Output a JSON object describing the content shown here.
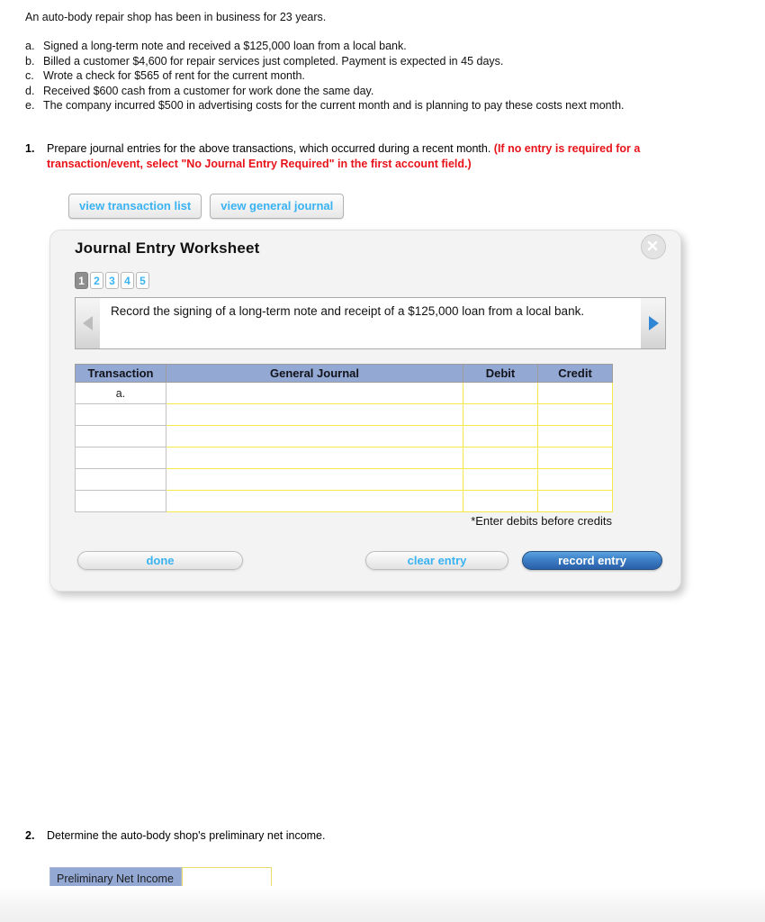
{
  "intro": "An auto-body repair shop has been in business for 23 years.",
  "transactions": [
    {
      "letter": "a.",
      "text": "Signed a long-term note and received a $125,000 loan from a local bank."
    },
    {
      "letter": "b.",
      "text": "Billed a customer $4,600 for repair services just completed. Payment is expected in 45 days."
    },
    {
      "letter": "c.",
      "text": "Wrote a check for $565 of rent for the current month."
    },
    {
      "letter": "d.",
      "text": "Received $600 cash from a customer for work done the same day."
    },
    {
      "letter": "e.",
      "text": "The company incurred $500 in advertising costs for the current month and is planning to pay these costs next month."
    }
  ],
  "question1": {
    "number": "1.",
    "text": "Prepare journal entries for the above transactions, which occurred during a recent month. ",
    "highlight": "(If no entry is required for a transaction/event, select \"No Journal Entry Required\" in the first account field.)"
  },
  "view_buttons": [
    {
      "label": "view transaction list"
    },
    {
      "label": "view general journal"
    }
  ],
  "worksheet": {
    "title": "Journal Entry Worksheet",
    "close_icon": "close-x-icon",
    "pager": [
      {
        "label": "1",
        "active": true
      },
      {
        "label": "2",
        "active": false
      },
      {
        "label": "3",
        "active": false
      },
      {
        "label": "4",
        "active": false
      },
      {
        "label": "5",
        "active": false
      }
    ],
    "prev_icon": "triangle-left-icon",
    "next_icon": "triangle-right-icon",
    "prompt": "Record the signing of a long-term note and receipt of a $125,000 loan from a local bank.",
    "table": {
      "headers": [
        "Transaction",
        "General Journal",
        "Debit",
        "Credit"
      ],
      "rows": [
        {
          "transaction": "a.",
          "general_journal": "",
          "debit": "",
          "credit": ""
        },
        {
          "transaction": "",
          "general_journal": "",
          "debit": "",
          "credit": ""
        },
        {
          "transaction": "",
          "general_journal": "",
          "debit": "",
          "credit": ""
        },
        {
          "transaction": "",
          "general_journal": "",
          "debit": "",
          "credit": ""
        },
        {
          "transaction": "",
          "general_journal": "",
          "debit": "",
          "credit": ""
        },
        {
          "transaction": "",
          "general_journal": "",
          "debit": "",
          "credit": ""
        }
      ]
    },
    "note": "*Enter debits before credits",
    "buttons": {
      "done": "done",
      "clear_entry": "clear entry",
      "record_entry": "record entry"
    }
  },
  "question2": {
    "number": "2.",
    "text": "Determine the auto-body shop's preliminary net income."
  },
  "net_income": {
    "label": "Preliminary Net Income",
    "value": "",
    "placeholder": ""
  },
  "colors": {
    "accent_blue": "#3ab3f2",
    "header_blue": "#93a9d4",
    "alert_red": "#e8131a",
    "record_button": "#2a5fa8",
    "input_border_yellow": "#f4e84a"
  }
}
